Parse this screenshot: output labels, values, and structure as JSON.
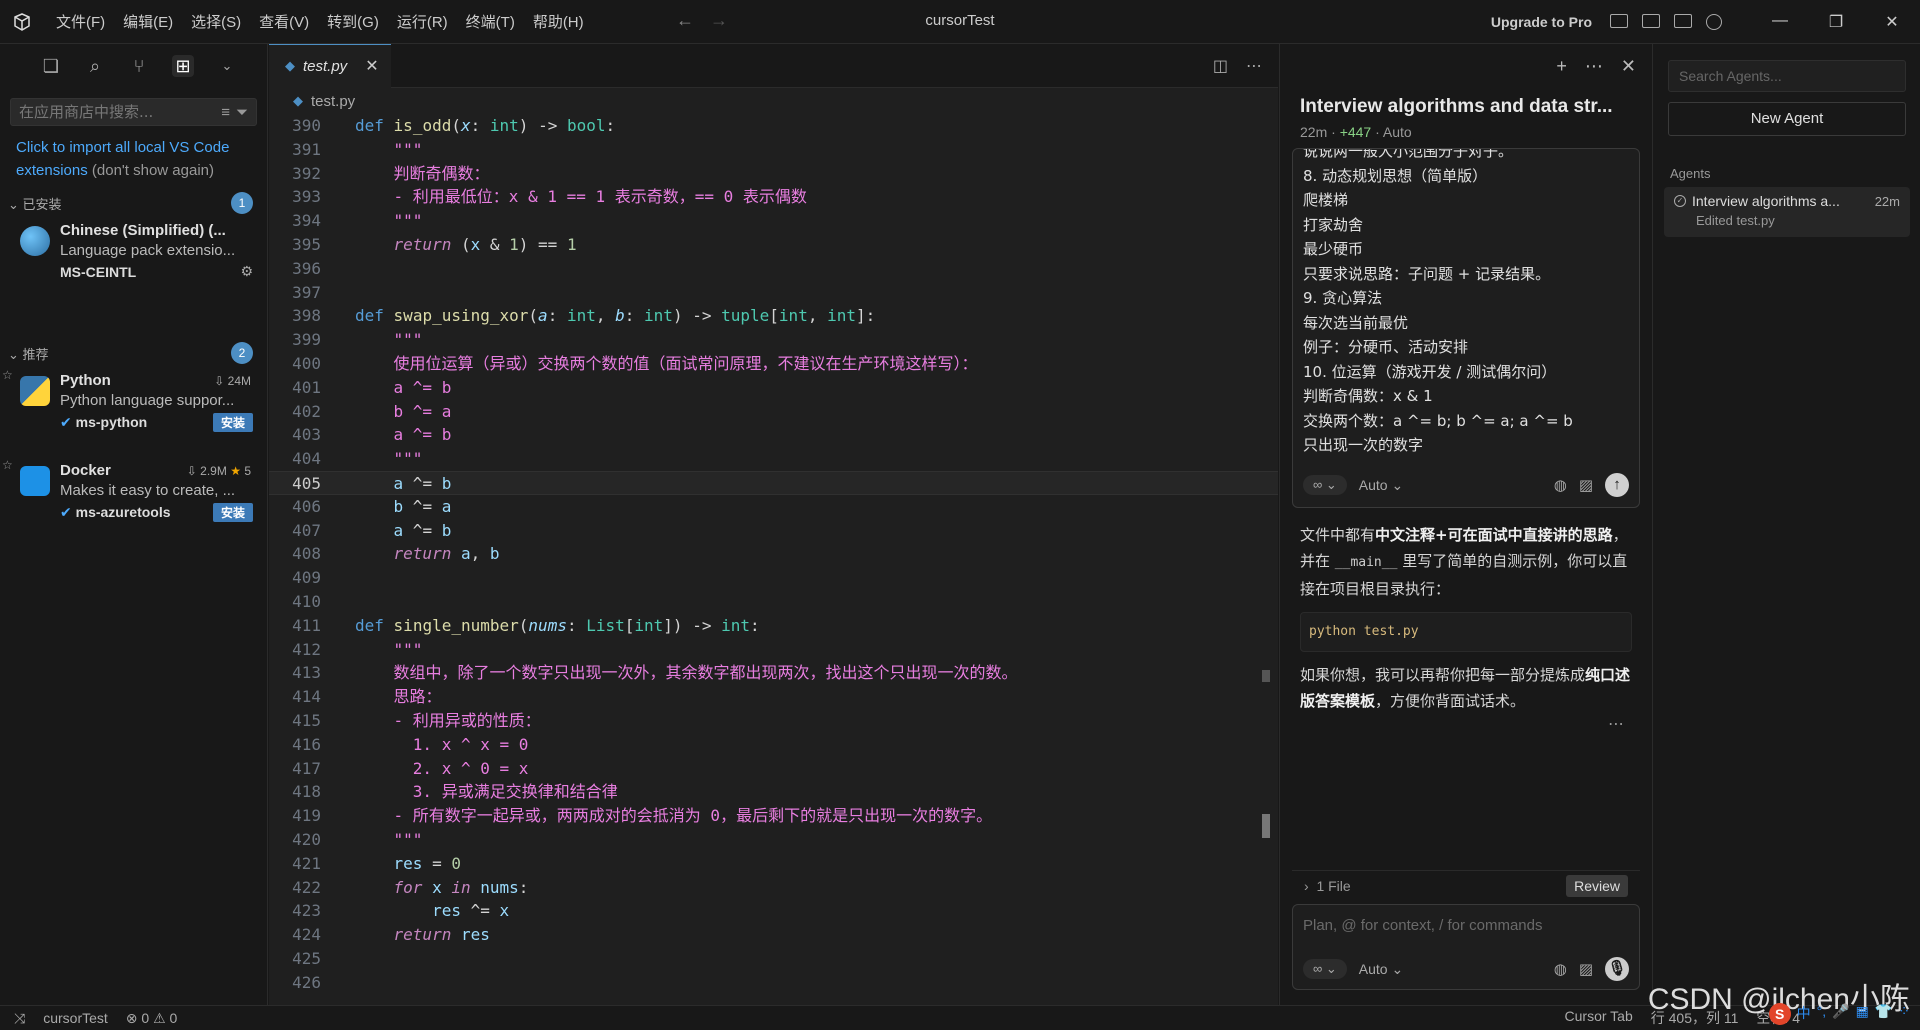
{
  "titlebar": {
    "menu": [
      "文件(F)",
      "编辑(E)",
      "选择(S)",
      "查看(V)",
      "转到(G)",
      "运行(R)",
      "终端(T)",
      "帮助(H)"
    ],
    "window_title": "cursorTest",
    "upgrade": "Upgrade to Pro"
  },
  "sidebar": {
    "search_placeholder": "在应用商店中搜索...",
    "import_link": "Click to import all local VS Code extensions",
    "import_dismiss": "(don't show again)",
    "installed": {
      "label": "已安装",
      "count": "1",
      "items": [
        {
          "name": "Chinese (Simplified) (...",
          "desc": "Language pack extensio...",
          "publisher": "MS-CEINTL"
        }
      ]
    },
    "recommended": {
      "label": "推荐",
      "count": "2",
      "items": [
        {
          "name": "Python",
          "downloads": "24M",
          "rating": "",
          "desc": "Python language suppor...",
          "publisher": "ms-python",
          "install": "安装"
        },
        {
          "name": "Docker",
          "downloads": "2.9M",
          "rating": "5",
          "desc": "Makes it easy to create, ...",
          "publisher": "ms-azuretools",
          "install": "安装"
        }
      ]
    }
  },
  "editor": {
    "tab": "test.py",
    "breadcrumb": "test.py",
    "current_line": 405
  },
  "chat": {
    "title": "Interview algorithms and data str...",
    "meta_time": "22m",
    "meta_added": "+447",
    "meta_mode": "Auto",
    "message_lines": [
      "说说两一般大小范围分子对子。",
      "8. 动态规划思想（简单版）",
      "爬楼梯",
      "打家劫舍",
      "最少硬币",
      "只要求说思路：子问题 + 记录结果。",
      "9. 贪心算法",
      "每次选当前最优",
      "例子：分硬币、活动安排",
      "10. 位运算（游戏开发 / 测试偶尔问）",
      "判断奇偶数：x & 1",
      "交换两个数：a ^= b; b ^= a; a ^= b",
      "只出现一次的数字"
    ],
    "mode_label": "Auto",
    "reply_part1": "文件中都有",
    "reply_bold1": "中文注释+可在面试中直接讲的思路",
    "reply_part2": "，并在",
    "reply_code": "__main__",
    "reply_part3": "里写了简单的自测示例，你可以直接在项目根目录执行：",
    "command": "python test.py",
    "reply2_part1": "如果你想，我可以再帮你把每一部分提炼成",
    "reply2_bold": "纯口述版答案模板",
    "reply2_part2": "，方便你背面试话术。",
    "files": "1 File",
    "review": "Review",
    "input_placeholder": "Plan, @ for context, / for commands",
    "input_mode": "Auto"
  },
  "agents": {
    "search_placeholder": "Search Agents...",
    "new_agent": "New Agent",
    "section": "Agents",
    "items": [
      {
        "name": "Interview algorithms a...",
        "time": "22m",
        "sub": "Edited test.py"
      }
    ]
  },
  "statusbar": {
    "project": "cursorTest",
    "errors": "0",
    "warnings": "0",
    "cursor_tab": "Cursor Tab",
    "position": "行 405，列 11",
    "indent": "空格: 4"
  },
  "watermark": "CSDN @jlchen小陈",
  "ime": [
    "中",
    "°,",
    "🎤",
    "▦",
    "👕",
    "⁘"
  ]
}
